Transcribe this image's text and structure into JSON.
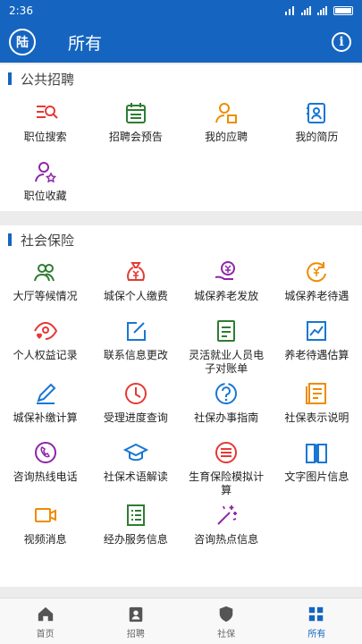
{
  "status": {
    "time": "2:36"
  },
  "header": {
    "logo": "陆",
    "title": "所有"
  },
  "sections": [
    {
      "title": "公共招聘",
      "items": [
        {
          "label": "职位搜索",
          "icon": "job-search-icon",
          "color": "#e53935"
        },
        {
          "label": "招聘会预告",
          "icon": "calendar-icon",
          "color": "#2e7d32"
        },
        {
          "label": "我的应聘",
          "icon": "user-apply-icon",
          "color": "#ef8c00"
        },
        {
          "label": "我的简历",
          "icon": "resume-icon",
          "color": "#1976d2"
        },
        {
          "label": "职位收藏",
          "icon": "user-star-icon",
          "color": "#8e24aa"
        }
      ]
    },
    {
      "title": "社会保险",
      "items": [
        {
          "label": "大厅等候情况",
          "icon": "people-icon",
          "color": "#2e7d32"
        },
        {
          "label": "城保个人缴费",
          "icon": "money-bag-icon",
          "color": "#e53935"
        },
        {
          "label": "城保养老发放",
          "icon": "yen-hand-icon",
          "color": "#8e24aa"
        },
        {
          "label": "城保养老待遇",
          "icon": "yen-refresh-icon",
          "color": "#ef8c00"
        },
        {
          "label": "个人权益记录",
          "icon": "eye-heart-icon",
          "color": "#e53935"
        },
        {
          "label": "联系信息更改",
          "icon": "edit-square-icon",
          "color": "#1976d2"
        },
        {
          "label": "灵活就业人员电子对账单",
          "icon": "document-icon",
          "color": "#2e7d32"
        },
        {
          "label": "养老待遇估算",
          "icon": "chart-line-icon",
          "color": "#1976d2"
        },
        {
          "label": "城保补缴计算",
          "icon": "pencil-icon",
          "color": "#1976d2"
        },
        {
          "label": "受理进度查询",
          "icon": "clock-icon",
          "color": "#e53935"
        },
        {
          "label": "社保办事指南",
          "icon": "question-icon",
          "color": "#1976d2"
        },
        {
          "label": "社保表示说明",
          "icon": "notes-icon",
          "color": "#ef8c00"
        },
        {
          "label": "咨询热线电话",
          "icon": "phone-icon",
          "color": "#8e24aa"
        },
        {
          "label": "社保术语解读",
          "icon": "graduation-cap-icon",
          "color": "#1976d2"
        },
        {
          "label": "生育保险模拟计算",
          "icon": "list-circle-icon",
          "color": "#e53935"
        },
        {
          "label": "文字图片信息",
          "icon": "book-icon",
          "color": "#1976d2"
        },
        {
          "label": "视频消息",
          "icon": "video-icon",
          "color": "#ef8c00"
        },
        {
          "label": "经办服务信息",
          "icon": "list-doc-icon",
          "color": "#2e7d32"
        },
        {
          "label": "咨询热点信息",
          "icon": "sparkle-icon",
          "color": "#8e24aa"
        }
      ]
    }
  ],
  "tabs": [
    {
      "label": "首页",
      "icon": "home-icon"
    },
    {
      "label": "招聘",
      "icon": "badge-icon"
    },
    {
      "label": "社保",
      "icon": "shield-icon"
    },
    {
      "label": "所有",
      "icon": "grid-icon",
      "active": true
    }
  ]
}
